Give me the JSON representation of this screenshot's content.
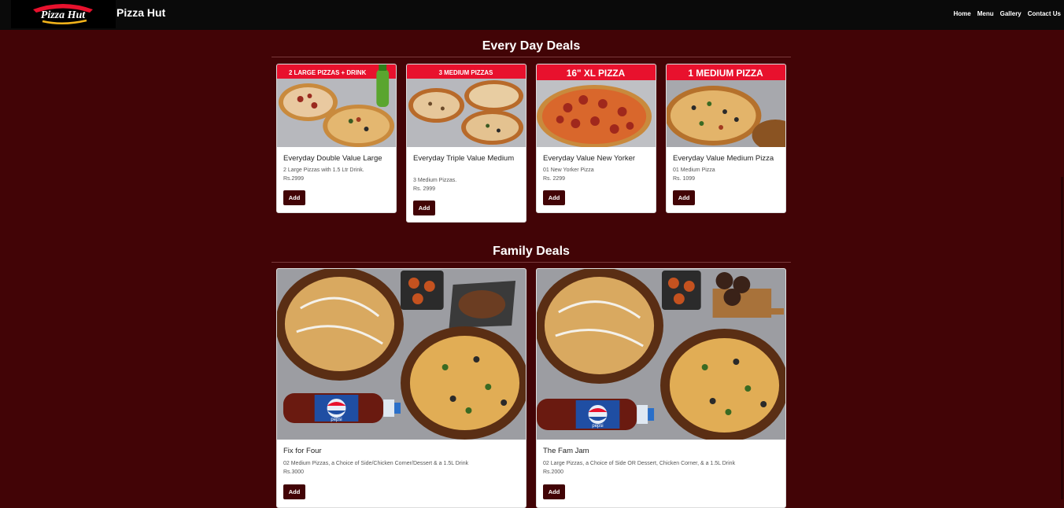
{
  "brand": {
    "name": "Pizza Hut",
    "logo_text": "Pizza Hut"
  },
  "nav": {
    "items": [
      "Home",
      "Menu",
      "Gallery",
      "Contact Us"
    ]
  },
  "sections": [
    {
      "title": "Every Day Deals",
      "cards": [
        {
          "banner": "2 LARGE PIZZAS + DRINK",
          "name": "Everyday Double Value Large",
          "desc": "2 Large Pizzas with 1.5 Ltr Drink.",
          "price": "Rs.2999",
          "button": "Add"
        },
        {
          "banner": "3 MEDIUM PIZZAS",
          "name": "Everyday Triple Value Medium",
          "desc": "3 Medium Pizzas.",
          "price": "Rs. 2999",
          "button": "Add"
        },
        {
          "banner": "16\" XL PIZZA",
          "name": "Everyday Value New Yorker",
          "desc": "01 New Yorker Pizza",
          "price": "Rs. 2299",
          "button": "Add"
        },
        {
          "banner": "1 MEDIUM PIZZA",
          "name": "Everyday Value Medium Pizza",
          "desc": "01 Medium Pizza",
          "price": "Rs. 1099",
          "button": "Add"
        }
      ]
    },
    {
      "title": "Family Deals",
      "cards": [
        {
          "name": "Fix for Four",
          "desc": "02 Medium Pizzas, a Choice of Side/Chicken Corner/Dessert & a 1.5L Drink",
          "price": "Rs.3000",
          "button": "Add",
          "bottle_label": "pepsi"
        },
        {
          "name": "The Fam Jam",
          "desc": "02 Large Pizzas, a Choice of Side OR Dessert, Chicken Corner, & a 1.5L Drink",
          "price": "Rs.2000",
          "button": "Add",
          "bottle_label": "pepsi"
        }
      ]
    }
  ],
  "colors": {
    "page_bg": "#420406",
    "navbar_bg": "#0a0a0a",
    "button_bg": "#420406",
    "banner_red": "#e8112d"
  }
}
